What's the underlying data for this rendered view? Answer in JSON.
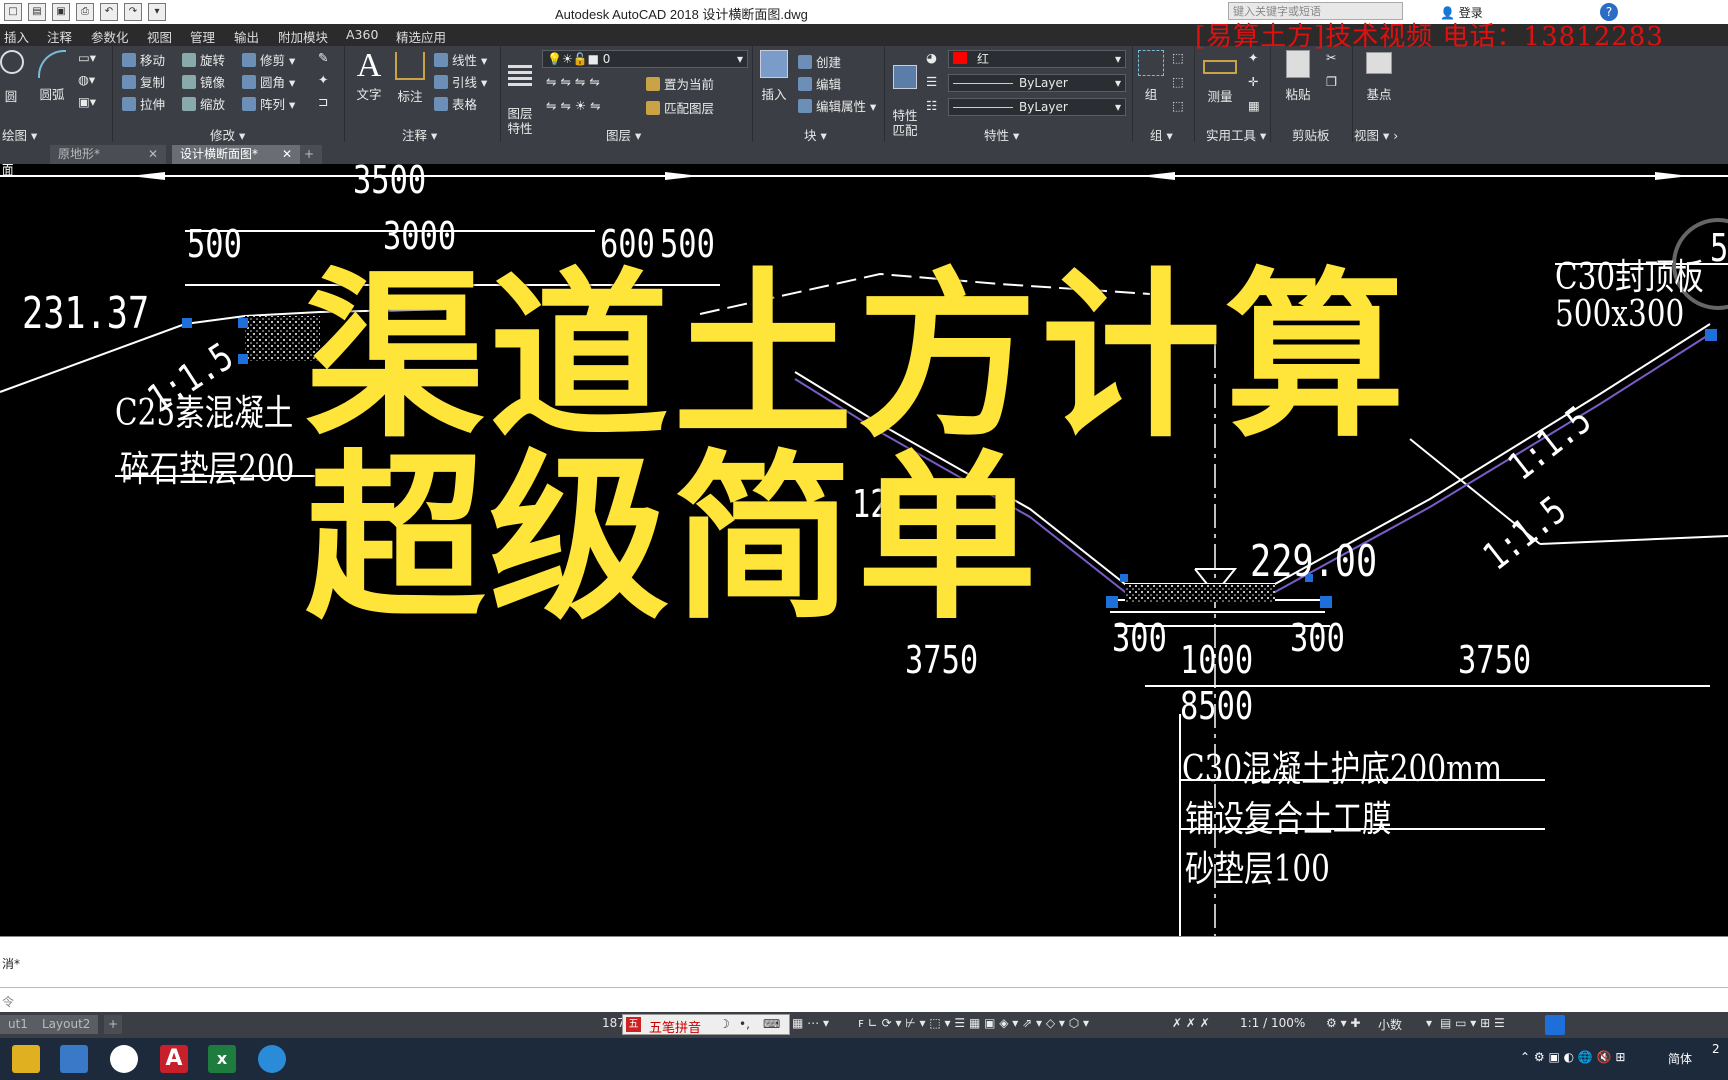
{
  "titlebar": {
    "title": "Autodesk AutoCAD 2018    设计横断面图.dwg",
    "promo": "[易算土方]技术视频 电话：13812283",
    "search_placeholder": "键入关键字或短语",
    "login": "登录"
  },
  "menu": [
    "插入",
    "注释",
    "参数化",
    "视图",
    "管理",
    "输出",
    "附加模块",
    "A360",
    "精选应用"
  ],
  "ribbon": {
    "draw": {
      "circle": "圆",
      "arc": "圆弧",
      "panel": "绘图"
    },
    "modify": {
      "move": "移动",
      "rotate": "旋转",
      "trim": "修剪",
      "copy": "复制",
      "mirror": "镜像",
      "fillet": "圆角",
      "stretch": "拉伸",
      "scale": "缩放",
      "array": "阵列",
      "panel": "修改"
    },
    "annotation": {
      "text": "文字",
      "dimension": "标注",
      "linear": "线性",
      "leader": "引线",
      "table": "表格",
      "panel": "注释"
    },
    "layers": {
      "props": "图层\n特性",
      "current_layer": "0",
      "set_current": "置为当前",
      "match_layer": "匹配图层",
      "panel": "图层"
    },
    "block": {
      "insert": "插入",
      "create": "创建",
      "edit": "编辑",
      "edit_attr": "编辑属性",
      "panel": "块"
    },
    "properties": {
      "match": "特性\n匹配",
      "color": "红",
      "linetype": "ByLayer",
      "lineweight": "ByLayer",
      "panel": "特性"
    },
    "groups": {
      "group": "组",
      "panel": "组"
    },
    "utilities": {
      "measure": "测量",
      "panel": "实用工具"
    },
    "clipboard": {
      "paste": "粘贴",
      "panel": "剪贴板"
    },
    "view": {
      "base": "基点",
      "panel": "视图"
    }
  },
  "tabs": [
    "原地形*",
    "设计横断面图*"
  ],
  "canvas": {
    "corner_label": "面",
    "dims": {
      "d3500": "3500",
      "d3000": "3000",
      "d500": "500",
      "d600": "600",
      "d500b": "500",
      "elev1": "231.37",
      "elev2": "229.00",
      "slope1": "1:1.5",
      "slope2": "1:1.5",
      "slope3": "1:1.5",
      "d300a": "300",
      "d1000": "1000",
      "d300b": "300",
      "d3750a": "3750",
      "d3750b": "3750",
      "d8500": "8500",
      "frag12": "12",
      "frag5": "5"
    },
    "notes": {
      "c25": "C25素混凝土",
      "gravel": "碎石垫层200",
      "c30_top": "C30封顶板",
      "size": "500x300",
      "c30_bottom": "C30混凝土护底200mm",
      "membrane": "铺设复合土工膜",
      "sand": "砂垫层100"
    },
    "overlay": {
      "line1": "渠道土方计算",
      "line2": "超级简单"
    }
  },
  "command": {
    "history": "消*",
    "prompt": "令"
  },
  "layout_tabs": [
    "ut1",
    "Layout2"
  ],
  "statusbar": {
    "coord": "187",
    "ime": "五笔拼音",
    "scale": "1:1 / 100%",
    "units": "小数"
  },
  "taskbar": {
    "lang": "简体",
    "time": "2"
  }
}
